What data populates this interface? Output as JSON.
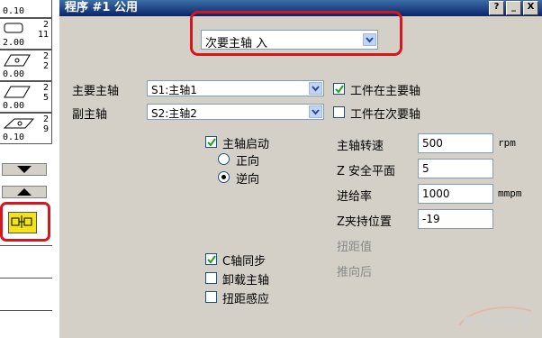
{
  "window": {
    "title": "程序 #1 公用",
    "buttons": [
      "?",
      "_",
      "X"
    ]
  },
  "left_strip": {
    "cells": [
      {
        "top_value": "0.10",
        "n1": "",
        "n2": "",
        "icon": "rounded-rect-tool-icon"
      },
      {
        "top_value": "",
        "n1": "2",
        "n2": "11",
        "value": "2.00",
        "icon": "rounded-rect-tool-icon"
      },
      {
        "top_value": "",
        "n1": "2",
        "n2": "2",
        "value": "0.00",
        "icon": "parallelogram-tool-icon"
      },
      {
        "top_value": "",
        "n1": "2",
        "n2": "5",
        "value": "0.00",
        "icon": "parallelogram-tool-icon"
      },
      {
        "top_value": "",
        "n1": "2",
        "n2": "9",
        "value": "0.10",
        "icon": "pointed-tool-icon"
      }
    ],
    "scroll_down_icon": "triangle-down-icon",
    "scroll_up_icon": "triangle-up-icon",
    "active_tool_icon": "spindle-transfer-tool-icon"
  },
  "top_combo": {
    "value": "次要主轴 入"
  },
  "spindle_section": {
    "main_spindle_label": "主要主轴",
    "main_spindle_value": "S1:主轴1",
    "sub_spindle_label": "副主轴",
    "sub_spindle_value": "S2:主轴2",
    "workpiece_main": {
      "label": "工件在主要轴",
      "checked": true
    },
    "workpiece_sub": {
      "label": "工件在次要轴",
      "checked": false
    }
  },
  "start_section": {
    "spindle_start": {
      "label": "主轴启动",
      "checked": true
    },
    "forward": {
      "label": "正向",
      "selected": false
    },
    "reverse": {
      "label": "逆向",
      "selected": true
    }
  },
  "params": {
    "spindle_speed": {
      "label": "主轴转速",
      "value": "500",
      "unit": "rpm"
    },
    "safe_plane": {
      "label": "Z 安全平面",
      "value": "5"
    },
    "feed_rate": {
      "label": "进给率",
      "value": "1000",
      "unit": "mmpm"
    },
    "z_clamp": {
      "label": "Z夹持位置",
      "value": "-19"
    },
    "torque": {
      "label": "扭距值"
    },
    "push_back": {
      "label": "推向后"
    }
  },
  "bottom_options": {
    "c_axis_sync": {
      "label": "C轴同步",
      "checked": true
    },
    "unload_spindle": {
      "label": "卸载主轴",
      "checked": false
    },
    "torque_sense": {
      "label": "扭距感应",
      "checked": false
    }
  },
  "watermark": {
    "text": "e-works"
  },
  "colors": {
    "title_bar": "#0a246a",
    "panel": "#d4d0c8",
    "highlight_ring": "#d8141c",
    "active_tool_fill": "#f2e418"
  }
}
